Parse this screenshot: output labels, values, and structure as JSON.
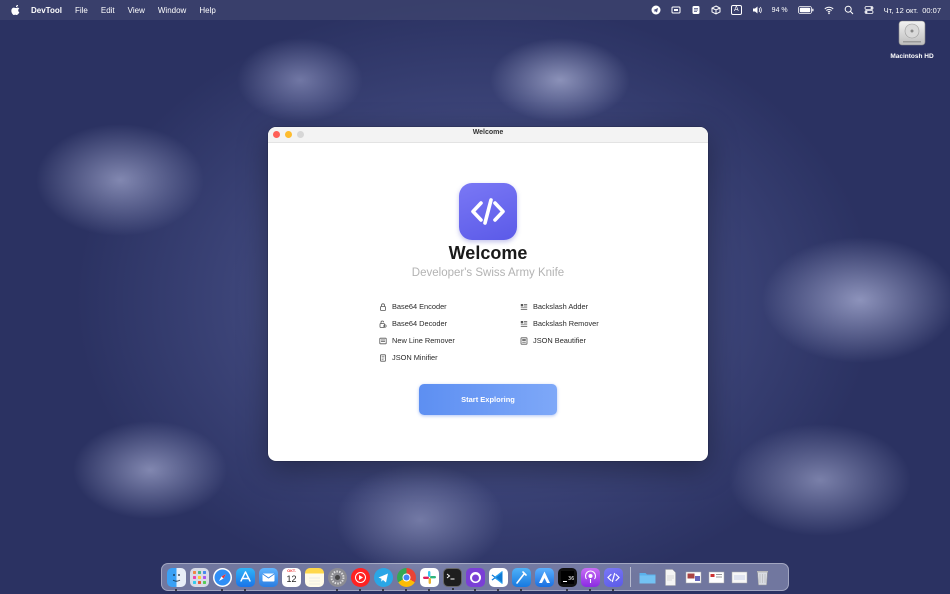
{
  "menubar": {
    "app_name": "DevTool",
    "items": [
      "File",
      "Edit",
      "View",
      "Window",
      "Help"
    ],
    "battery": "94 %",
    "keyboard_layout": "A",
    "datetime": "Чт, 12 окт.  00:07"
  },
  "desktop": {
    "disk_label": "Macintosh HD"
  },
  "window": {
    "title": "Welcome",
    "heading": "Welcome",
    "subtitle": "Developer's Swiss Army Knife",
    "features_left": [
      "Base64 Encoder",
      "Base64 Decoder",
      "New Line Remover",
      "JSON Minifier"
    ],
    "features_right": [
      "Backslash Adder",
      "Backslash Remover",
      "JSON Beautifier"
    ],
    "start_button": "Start Exploring",
    "accent_color": "#5b5ae8",
    "button_color": "#6b9af5"
  },
  "dock": {
    "calendar_month": "ОКТ.",
    "calendar_day": "12",
    "apps": [
      "finder",
      "launchpad",
      "safari",
      "app-store",
      "mail",
      "calendar",
      "notes",
      "system-settings",
      "youtube-music",
      "telegram",
      "chrome",
      "slack",
      "terminal",
      "github-desktop",
      "vscode",
      "xcode",
      "testflight",
      "ide",
      "podcasts",
      "devtool",
      "downloads-folder",
      "document",
      "preview",
      "finder-window",
      "trash"
    ]
  }
}
